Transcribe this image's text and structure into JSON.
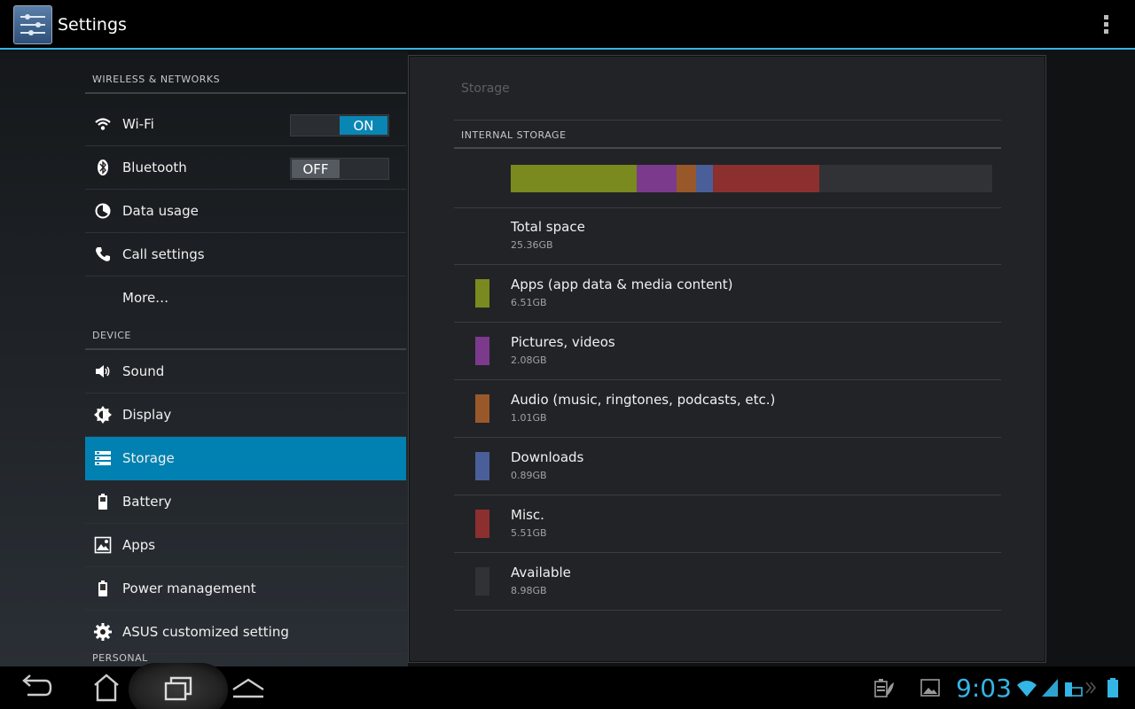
{
  "app": {
    "title": "Settings",
    "icon": "settings-sliders-icon"
  },
  "action_bar": {
    "overflow_icon": "overflow-menu-icon"
  },
  "sidebar": {
    "sections": [
      {
        "header": "WIRELESS & NETWORKS"
      },
      {
        "header": "DEVICE"
      },
      {
        "header": "PERSONAL"
      }
    ],
    "items": [
      {
        "label": "Wi-Fi",
        "icon": "wifi-icon",
        "toggle": "ON"
      },
      {
        "label": "Bluetooth",
        "icon": "bluetooth-icon",
        "toggle": "OFF"
      },
      {
        "label": "Data usage",
        "icon": "data-usage-icon"
      },
      {
        "label": "Call settings",
        "icon": "phone-icon"
      },
      {
        "label": "More…",
        "icon": ""
      },
      {
        "label": "Sound",
        "icon": "speaker-icon"
      },
      {
        "label": "Display",
        "icon": "brightness-icon"
      },
      {
        "label": "Storage",
        "icon": "storage-icon",
        "selected": true
      },
      {
        "label": "Battery",
        "icon": "battery-icon"
      },
      {
        "label": "Apps",
        "icon": "apps-icon"
      },
      {
        "label": "Power management",
        "icon": "power-battery-icon"
      },
      {
        "label": "ASUS customized setting",
        "icon": "gear-icon"
      }
    ]
  },
  "storage": {
    "breadcrumb": "Storage",
    "section_header": "INTERNAL STORAGE",
    "total": {
      "label": "Total space",
      "value": "25.36GB"
    },
    "categories": [
      {
        "label": "Apps (app data & media content)",
        "value": "6.51GB",
        "gb": 6.51,
        "color": "#7a8a1f"
      },
      {
        "label": "Pictures, videos",
        "value": "2.08GB",
        "gb": 2.08,
        "color": "#7b3a8c"
      },
      {
        "label": "Audio (music, ringtones, podcasts, etc.)",
        "value": "1.01GB",
        "gb": 1.01,
        "color": "#99582a"
      },
      {
        "label": "Downloads",
        "value": "0.89GB",
        "gb": 0.89,
        "color": "#4a5f99"
      },
      {
        "label": "Misc.",
        "value": "5.51GB",
        "gb": 5.51,
        "color": "#8c2f2f"
      },
      {
        "label": "Available",
        "value": "8.98GB",
        "gb": 8.98,
        "color": "#313236"
      }
    ]
  },
  "system_bar": {
    "back_icon": "back-icon",
    "home_icon": "home-icon",
    "recents_icon": "recent-apps-icon",
    "menu_icon": "up-chevron-icon",
    "clock": "9:03",
    "status_icons": [
      "battery-saver-icon",
      "gallery-notification-icon",
      "wifi-signal-icon",
      "cell-signal-icon",
      "dock-battery-icon",
      "battery-icon"
    ]
  },
  "colors": {
    "accent": "#33b5e5",
    "selected": "#0081b1"
  }
}
